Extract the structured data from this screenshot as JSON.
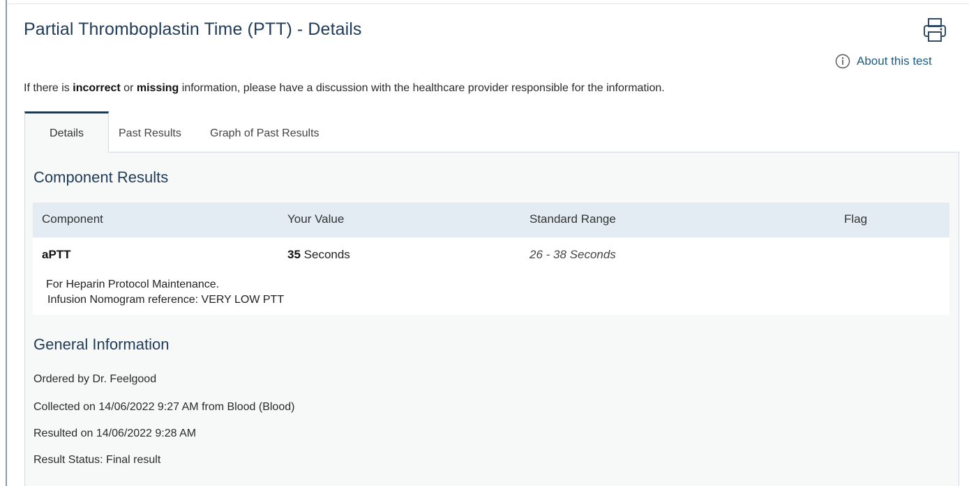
{
  "page": {
    "title": "Partial Thromboplastin Time (PTT) - Details",
    "about_link": "About this test",
    "notice": {
      "part1": "If there is ",
      "bold1": "incorrect",
      "part2": " or ",
      "bold2": "missing",
      "part3": " information, please have a discussion with the healthcare provider responsible for the information."
    }
  },
  "icons": {
    "print": "printer-icon",
    "info": "info-circle-icon"
  },
  "tabs": [
    {
      "label": "Details",
      "active": true
    },
    {
      "label": "Past Results",
      "active": false
    },
    {
      "label": "Graph of Past Results",
      "active": false
    }
  ],
  "component_results": {
    "heading": "Component Results",
    "columns": {
      "component": "Component",
      "value": "Your Value",
      "range": "Standard Range",
      "flag": "Flag"
    },
    "rows": [
      {
        "component": "aPTT",
        "value_number": "35",
        "value_unit": " Seconds",
        "range": "26 - 38 Seconds",
        "flag": "",
        "comment_line1": "For Heparin Protocol Maintenance.",
        "comment_line2": "Infusion Nomogram reference: VERY LOW PTT"
      }
    ]
  },
  "general_information": {
    "heading": "General Information",
    "ordered_by": "Ordered by Dr. Feelgood",
    "collected": "Collected on 14/06/2022 9:27 AM from Blood (Blood)",
    "resulted": "Resulted on 14/06/2022 9:28 AM",
    "status": "Result Status: Final result"
  },
  "colors": {
    "title": "#1f3b57",
    "link": "#1f5a80",
    "table_header_bg": "#e4ecf3",
    "panel_bg": "#f7f8f8",
    "active_tab_border": "#1d3a52"
  }
}
